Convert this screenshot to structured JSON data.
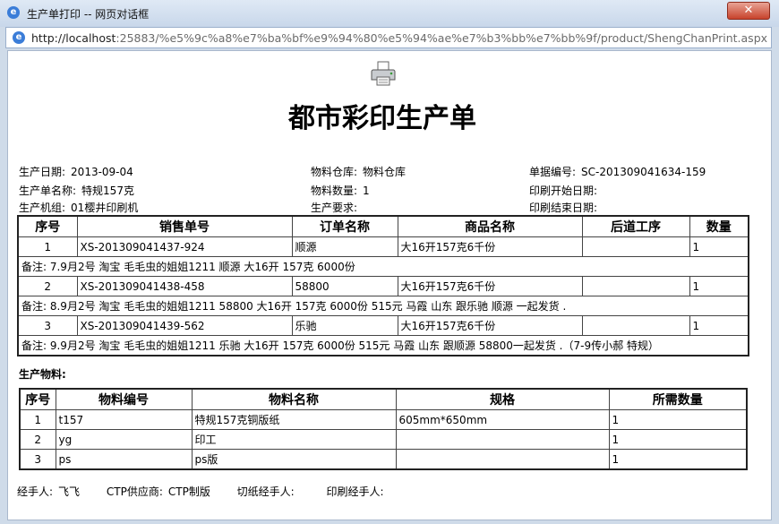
{
  "window": {
    "title": "生产单打印  -- 网页对话框",
    "close_label": "✕"
  },
  "address": {
    "host": "http://localhost",
    "path": ":25883/%e5%9c%a8%e7%ba%bf%e9%94%80%e5%94%ae%e7%b3%bb%e7%bb%9f/product/ShengChanPrint.aspx?OrderNo"
  },
  "doc": {
    "title": "都市彩印生产单",
    "info_left": [
      {
        "label": "生产日期:",
        "value": "2013-09-04"
      },
      {
        "label": "生产单名称:",
        "value": "特规157克"
      },
      {
        "label": "生产机组:",
        "value": "01樱井印刷机"
      }
    ],
    "info_mid": [
      {
        "label": "物料仓库:",
        "value": "物料仓库"
      },
      {
        "label": "物料数量:",
        "value": "1"
      },
      {
        "label": "生产要求:",
        "value": ""
      }
    ],
    "info_right": [
      {
        "label": "单据编号:",
        "value": "SC-201309041634-159"
      },
      {
        "label": "印刷开始日期:",
        "value": ""
      },
      {
        "label": "印刷结束日期:",
        "value": ""
      }
    ]
  },
  "orders": {
    "headers": [
      "序号",
      "销售单号",
      "订单名称",
      "商品名称",
      "后道工序",
      "数量"
    ],
    "rows": [
      {
        "no": "1",
        "sale_no": "XS-201309041437-924",
        "order_name": "顺源",
        "product": "大16开157克6千份",
        "post": "",
        "qty": "1",
        "remark": "备注:   7.9月2号  淘宝  毛毛虫的姐姐1211 顺源  大16开   157克  6000份"
      },
      {
        "no": "2",
        "sale_no": "XS-201309041438-458",
        "order_name": "58800",
        "product": "大16开157克6千份",
        "post": "",
        "qty": "1",
        "remark": "备注:   8.9月2号  淘宝  毛毛虫的姐姐1211 58800 大16开   157克  6000份  515元  马霞  山东  跟乐驰  顺源  一起发货 ."
      },
      {
        "no": "3",
        "sale_no": "XS-201309041439-562",
        "order_name": "乐驰",
        "product": "大16开157克6千份",
        "post": "",
        "qty": "1",
        "remark": "备注:   9.9月2号  淘宝  毛毛虫的姐姐1211 乐驰  大16开   157克  6000份  515元  马霞  山东  跟顺源  58800一起发货 .（7-9传小郝  特规）"
      }
    ]
  },
  "materials": {
    "section_title": "生产物料:",
    "headers": [
      "序号",
      "物料编号",
      "物料名称",
      "规格",
      "所需数量"
    ],
    "rows": [
      {
        "no": "1",
        "code": "t157",
        "name": "特规157克铜版纸",
        "spec": "605mm*650mm",
        "qty": "1"
      },
      {
        "no": "2",
        "code": "yg",
        "name": "印工",
        "spec": "",
        "qty": "1"
      },
      {
        "no": "3",
        "code": "ps",
        "name": "ps版",
        "spec": "",
        "qty": "1"
      }
    ]
  },
  "footer": [
    {
      "label": "经手人:",
      "value": "飞飞"
    },
    {
      "label": "CTP供应商:",
      "value": "CTP制版"
    },
    {
      "label": "切纸经手人:",
      "value": ""
    },
    {
      "label": "印刷经手人:",
      "value": ""
    }
  ]
}
